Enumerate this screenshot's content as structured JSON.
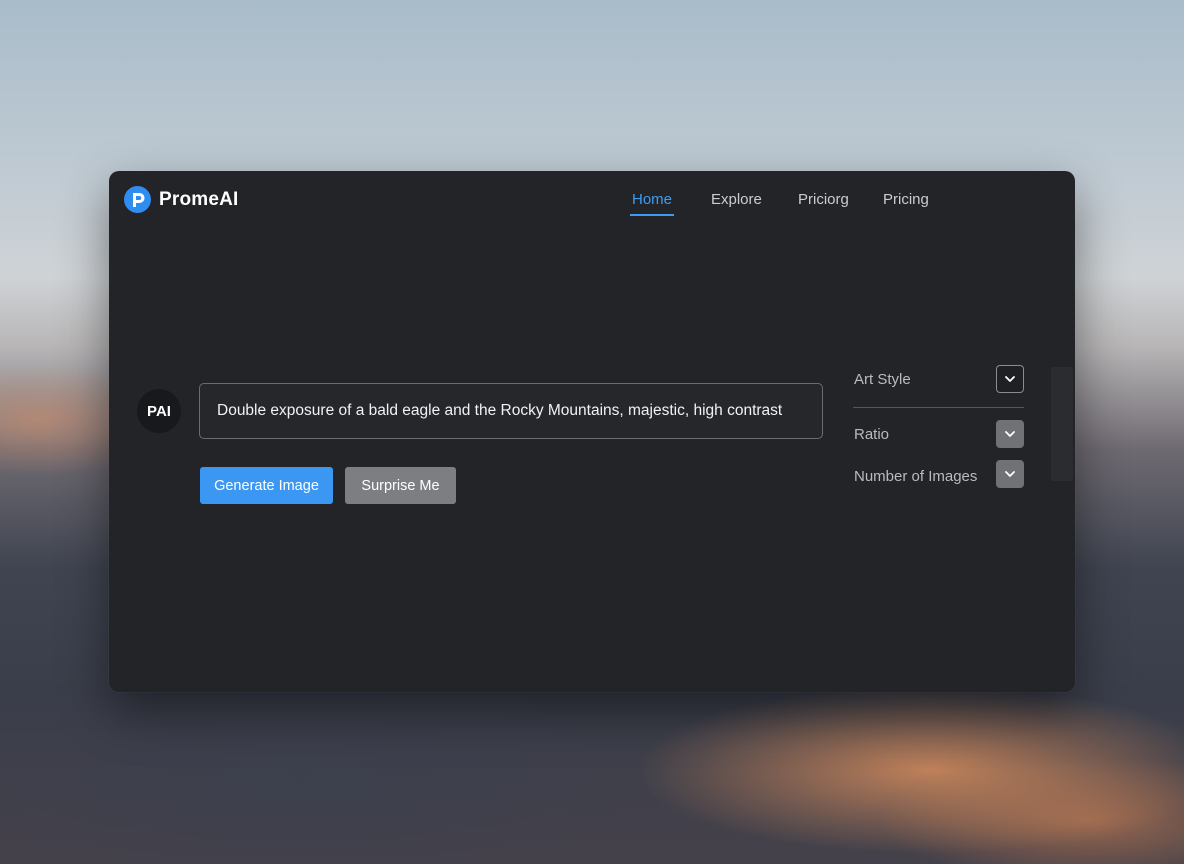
{
  "brand": {
    "name": "PromeAI"
  },
  "nav": [
    {
      "label": "Home",
      "active": true
    },
    {
      "label": "Explore",
      "active": false
    },
    {
      "label": "Priciorg",
      "active": false
    },
    {
      "label": "Pricing",
      "active": false
    }
  ],
  "avatar": {
    "text": "PAI"
  },
  "prompt": {
    "value": "Double exposure of a bald eagle and the Rocky Mountains, majestic, high contrast"
  },
  "buttons": {
    "generate": "Generate Image",
    "surprise": "Surprise Me"
  },
  "settings": [
    {
      "label": "Art Style",
      "icon": "chevron-down-icon"
    },
    {
      "label": "Ratio",
      "icon": "chevron-down-icon"
    },
    {
      "label": "Number of Images",
      "icon": "chevron-down-icon"
    }
  ],
  "colors": {
    "accent": "#3b97f2",
    "window_bg": "#232428",
    "secondary_button": "#7c7e82"
  }
}
